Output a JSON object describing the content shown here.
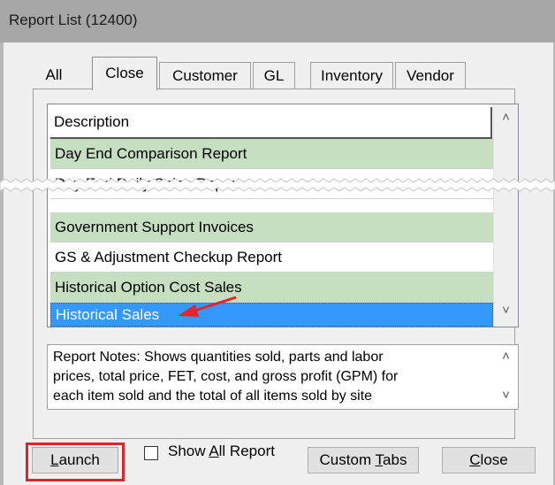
{
  "window": {
    "title": "Report List (12400)"
  },
  "tabs": [
    {
      "label": "All"
    },
    {
      "label": "Close"
    },
    {
      "label": "Customer"
    },
    {
      "label": "GL"
    },
    {
      "label": "Inventory"
    },
    {
      "label": "Vendor"
    }
  ],
  "list": {
    "header": "Description",
    "rows": [
      {
        "label": "Day End Comparison Report"
      },
      {
        "label": "Day End Daily Sales Report"
      },
      {
        "label": "Government Support Invoices"
      },
      {
        "label": "GS & Adjustment Checkup Report"
      },
      {
        "label": "Historical Option Cost Sales"
      },
      {
        "label": "Historical Sales"
      }
    ]
  },
  "notes": {
    "line1": "Report Notes:  Shows quantities sold, parts and labor",
    "line2": "prices, total price, FET, cost, and gross profit (GPM) for",
    "line3": "each item sold and the total of all items sold by site"
  },
  "buttons": {
    "launch_u": "L",
    "launch_rest": "aunch",
    "show_all_pre": "Show ",
    "show_all_u": "A",
    "show_all_rest": "ll Report",
    "custom_pre": "Custom ",
    "custom_u": "T",
    "custom_rest": "abs",
    "close_u": "C",
    "close_rest": "lose"
  },
  "colors": {
    "selection": "#3399ff",
    "row_green": "#c5dfc0",
    "highlight": "#d9262c",
    "arrow": "#e0262b"
  }
}
